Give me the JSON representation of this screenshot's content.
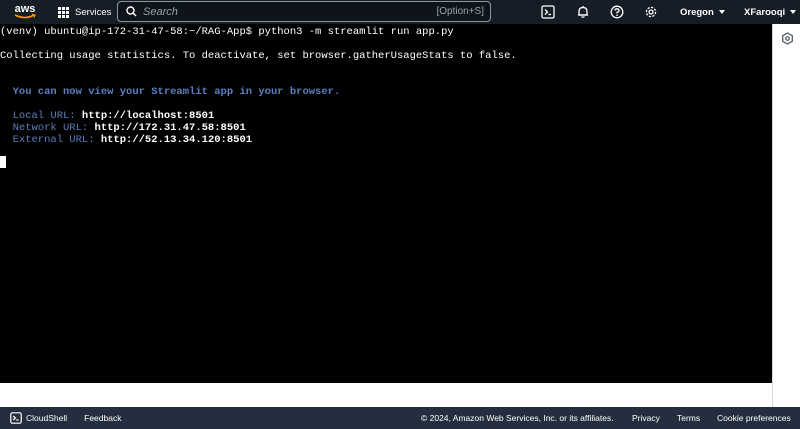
{
  "topbar": {
    "logo_text": "aws",
    "services_label": "Services",
    "search_placeholder": "Search",
    "search_shortcut": "[Option+S]",
    "region_label": "Oregon",
    "user_label": "XFarooqi",
    "icons": [
      "cloudshell-icon",
      "bell-icon",
      "help-icon",
      "gear-icon"
    ]
  },
  "terminal": {
    "prompt_line": "(venv) ubuntu@ip-172-31-47-58:~/RAG-App$ python3 -m streamlit run app.py",
    "stats_line": "Collecting usage statistics. To deactivate, set browser.gatherUsageStats to false.",
    "view_message": "  You can now view your Streamlit app in your browser.",
    "urls": [
      {
        "label": "  Local URL: ",
        "value": "http://localhost:8501"
      },
      {
        "label": "  Network URL: ",
        "value": "http://172.31.47.58:8501"
      },
      {
        "label": "  External URL: ",
        "value": "http://52.13.34.120:8501"
      }
    ],
    "colors": {
      "background": "#000000",
      "text": "#ffffff",
      "accent": "#5b7fbf"
    }
  },
  "footer": {
    "cloudshell_label": "CloudShell",
    "feedback_label": "Feedback",
    "copyright": "© 2024, Amazon Web Services, Inc. or its affiliates.",
    "privacy_label": "Privacy",
    "terms_label": "Terms",
    "cookie_label": "Cookie preferences"
  }
}
